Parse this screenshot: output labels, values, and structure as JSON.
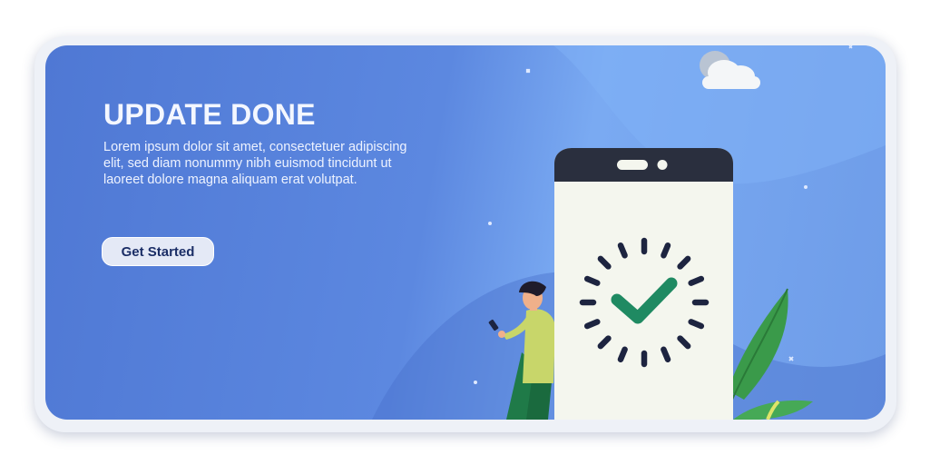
{
  "banner": {
    "title": "UPDATE DONE",
    "description": "Lorem ipsum dolor sit amet, consectetuer adipiscing elit, sed diam nonummy nibh euismod tincidunt ut laoreet dolore magna aliquam erat volutpat.",
    "cta_label": "Get Started"
  },
  "illustration": {
    "icons": [
      "cloud-icon",
      "smartphone-icon",
      "check-icon",
      "loading-spinner-icon",
      "person-icon",
      "leaf-icon",
      "sparkle-icon"
    ],
    "colors": {
      "background_start": "#4f78d4",
      "background_end": "#7aaaf2",
      "phone_notch": "#2a2f3e",
      "phone_screen": "#f4f6ee",
      "check": "#1f8a62",
      "spinner": "#1d2440",
      "leaf": "#3a9a4a",
      "person_shirt": "#c8d66a",
      "person_pants": "#1f7a48"
    }
  }
}
